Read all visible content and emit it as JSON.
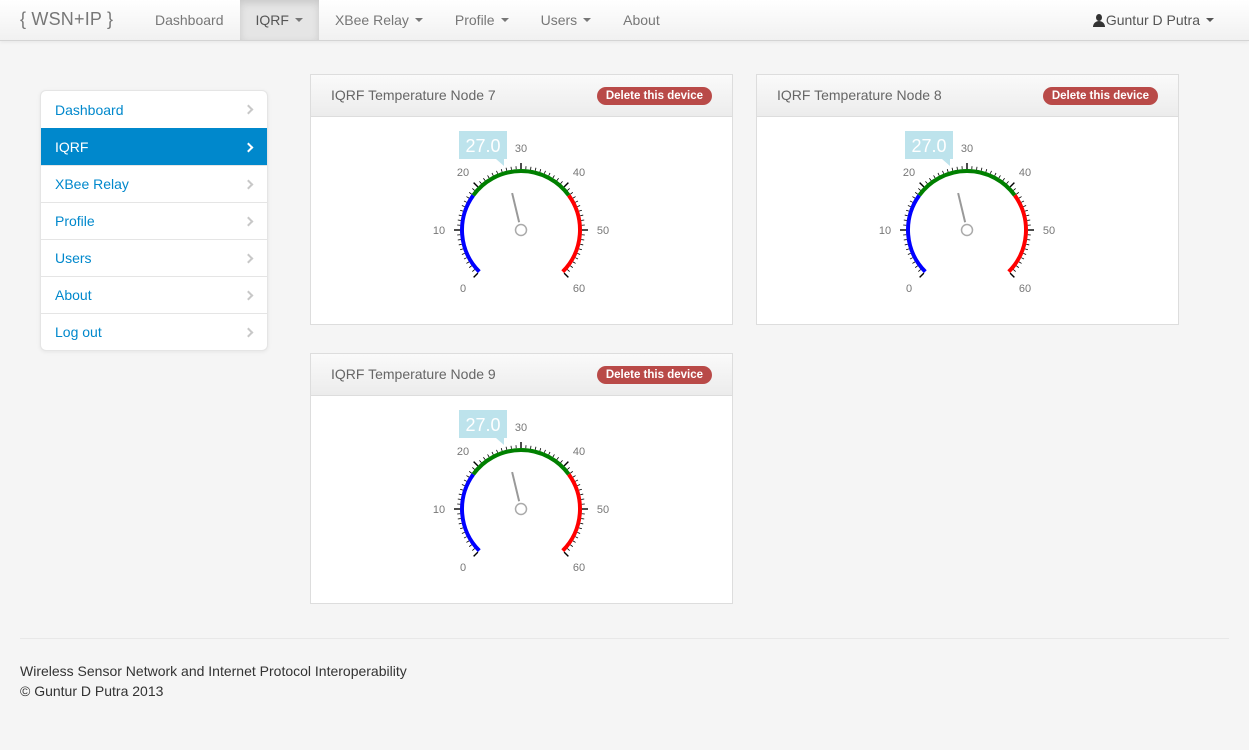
{
  "brand": "{ WSN+IP }",
  "nav": [
    {
      "label": "Dashboard",
      "caret": false
    },
    {
      "label": "IQRF",
      "caret": true
    },
    {
      "label": "XBee Relay",
      "caret": true
    },
    {
      "label": "Profile",
      "caret": true
    },
    {
      "label": "Users",
      "caret": true
    },
    {
      "label": "About",
      "caret": false
    }
  ],
  "user_menu": {
    "name": "Guntur D Putra"
  },
  "sidebar": {
    "items": [
      {
        "label": "Dashboard"
      },
      {
        "label": "IQRF"
      },
      {
        "label": "XBee Relay"
      },
      {
        "label": "Profile"
      },
      {
        "label": "Users"
      },
      {
        "label": "About"
      },
      {
        "label": "Log out"
      }
    ]
  },
  "gauge_scale": {
    "min": 0,
    "max": 60,
    "tick_labels": [
      "0",
      "10",
      "20",
      "30",
      "40",
      "50",
      "60"
    ]
  },
  "panels": [
    {
      "title": "IQRF Temperature Node 7",
      "delete_label": "Delete this device",
      "value": 27.0,
      "value_label": "27.0"
    },
    {
      "title": "IQRF Temperature Node 8",
      "delete_label": "Delete this device",
      "value": 27.0,
      "value_label": "27.0"
    },
    {
      "title": "IQRF Temperature Node 9",
      "delete_label": "Delete this device",
      "value": 27.0,
      "value_label": "27.0"
    }
  ],
  "colors": {
    "accent": "#0088cc",
    "danger": "#b94a48",
    "band_low": "#0000ff",
    "band_mid": "#008000",
    "band_high": "#ff0000",
    "value_box": "#bde3ec"
  },
  "footer": {
    "line1": "Wireless Sensor Network and Internet Protocol Interoperability",
    "line2": "© Guntur D Putra 2013"
  }
}
